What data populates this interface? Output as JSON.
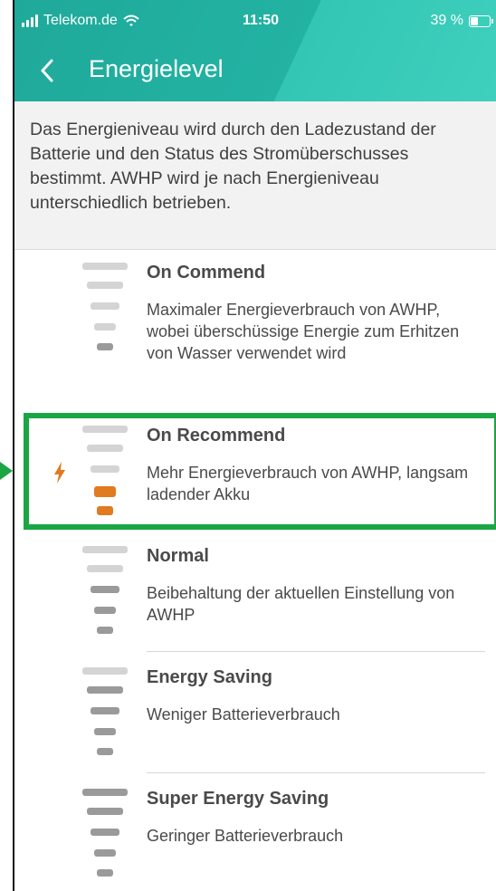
{
  "status_bar": {
    "carrier": "Telekom.de",
    "time": "11:50",
    "battery": "39 %"
  },
  "nav": {
    "title": "Energielevel"
  },
  "intro": {
    "text": "Das Energieniveau wird durch den Ladezustand der Batterie und den Status des Stromüberschusses bestimmt. AWHP wird je nach Energieniveau unterschiedlich betrieben."
  },
  "levels": [
    {
      "name": "On Commend",
      "description": "Maximaler Energieverbrauch von AWHP, wobei überschüssige Energie zum Erhitzen von Wasser verwendet wird",
      "filled_bars": 1,
      "charging": false
    },
    {
      "name": "On Recommend",
      "description": "Mehr Energieverbrauch von AWHP, langsam ladender Akku",
      "filled_bars": 2,
      "charging": true
    },
    {
      "name": "Normal",
      "description": "Beibehaltung der aktuellen Einstellung von AWHP",
      "filled_bars": 3,
      "charging": false
    },
    {
      "name": "Energy Saving",
      "description": "Weniger Batterieverbrauch",
      "filled_bars": 4,
      "charging": false
    },
    {
      "name": "Super Energy Saving",
      "description": "Geringer Batterieverbrauch",
      "filled_bars": 5,
      "charging": false
    }
  ],
  "colors": {
    "header": "#23b3a3",
    "highlight": "#1aa645",
    "bar_light": "#d4d4d4",
    "bar_dark": "#9a9a9a",
    "bar_orange": "#e07b1f"
  },
  "icons": {
    "back": "chevron-left-icon",
    "bolt": "lightning-bolt-icon",
    "wifi": "wifi-icon",
    "signal": "signal-bars-icon",
    "battery": "battery-icon"
  }
}
